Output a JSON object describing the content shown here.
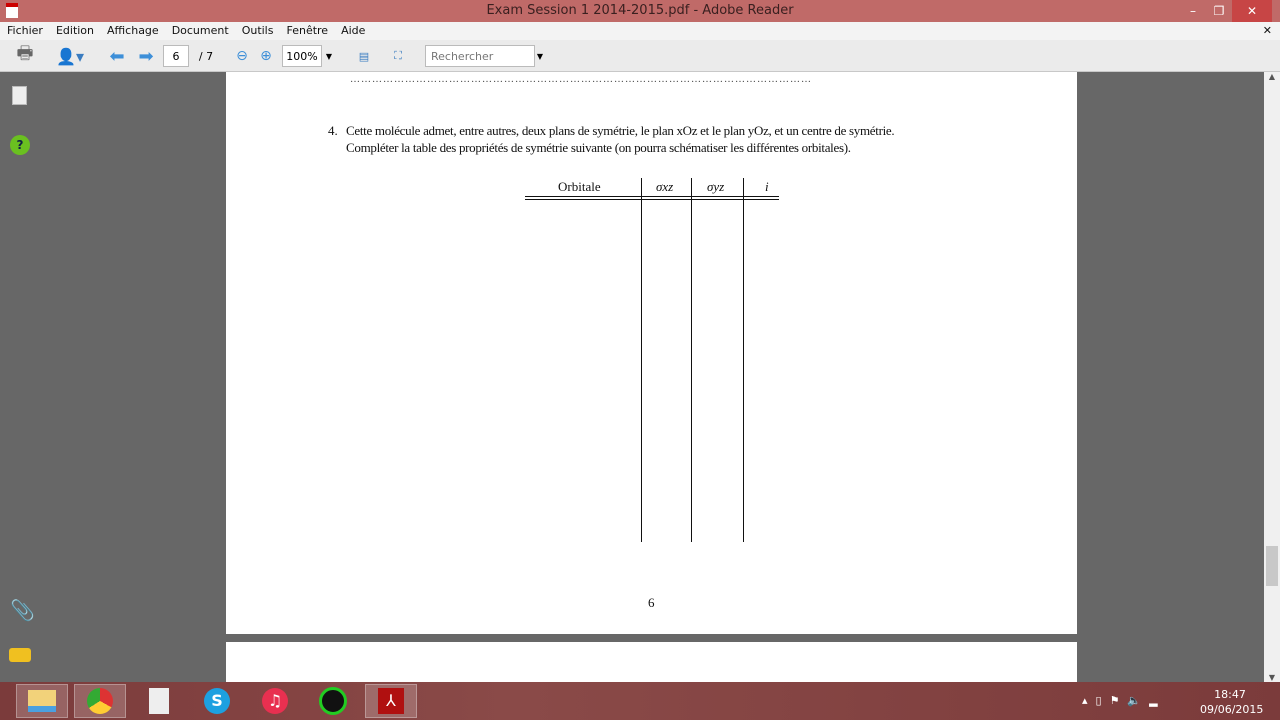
{
  "window": {
    "title": "Exam Session 1 2014-2015.pdf - Adobe Reader"
  },
  "menu": [
    "Fichier",
    "Edition",
    "Affichage",
    "Document",
    "Outils",
    "Fenêtre",
    "Aide"
  ],
  "toolbar": {
    "page_current": "6",
    "page_total": "/ 7",
    "zoom": "100%",
    "search_placeholder": "Rechercher"
  },
  "document": {
    "dots": "………………………………………………………………………………………………………………",
    "question_number": "4.",
    "line1": "Cette molécule admet, entre autres, deux plans de symétrie, le plan xOz et le plan yOz, et un centre de symétrie.",
    "line2": "Compléter la table des propriétés de symétrie suivante (on pourra schématiser les différentes orbitales).",
    "table_headers": [
      "Orbitale",
      "σxz",
      "σyz",
      "i"
    ],
    "page_number": "6"
  },
  "taskbar": {
    "time": "18:47",
    "date": "09/06/2015"
  }
}
